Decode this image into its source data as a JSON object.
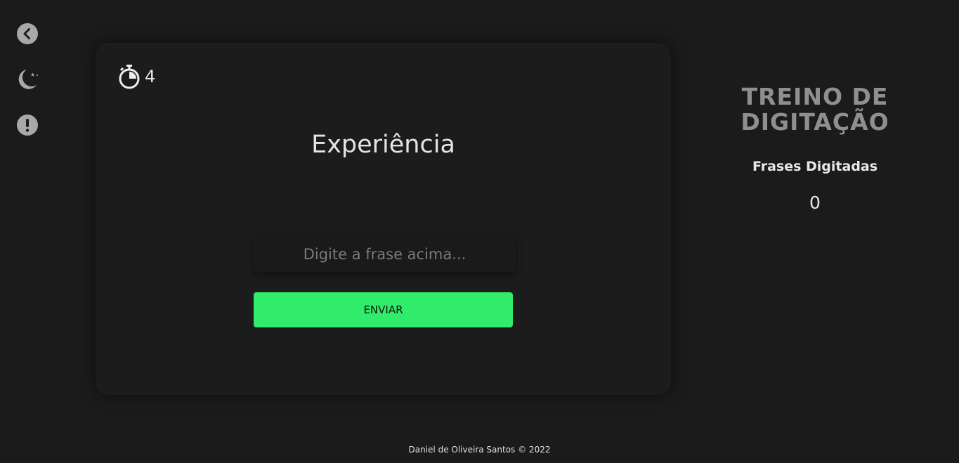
{
  "sidebar": {
    "items": [
      {
        "icon": "back-arrow-icon"
      },
      {
        "icon": "moon-icon"
      },
      {
        "icon": "exclamation-icon"
      }
    ]
  },
  "game": {
    "timer_icon": "stopwatch-icon",
    "timer_value": "4",
    "phrase": "Experiência",
    "input_placeholder": "Digite a frase acima...",
    "input_value": "",
    "submit_label": "ENVIAR"
  },
  "stats": {
    "title": "TREINO DE DIGITAÇÃO",
    "subtitle": "Frases Digitadas",
    "count": "0"
  },
  "footer": {
    "text": "Daniel de Oliveira Santos © 2022"
  },
  "colors": {
    "accent": "#31ec6b",
    "background": "#1b1b1b",
    "icon": "#a8a8a8"
  }
}
